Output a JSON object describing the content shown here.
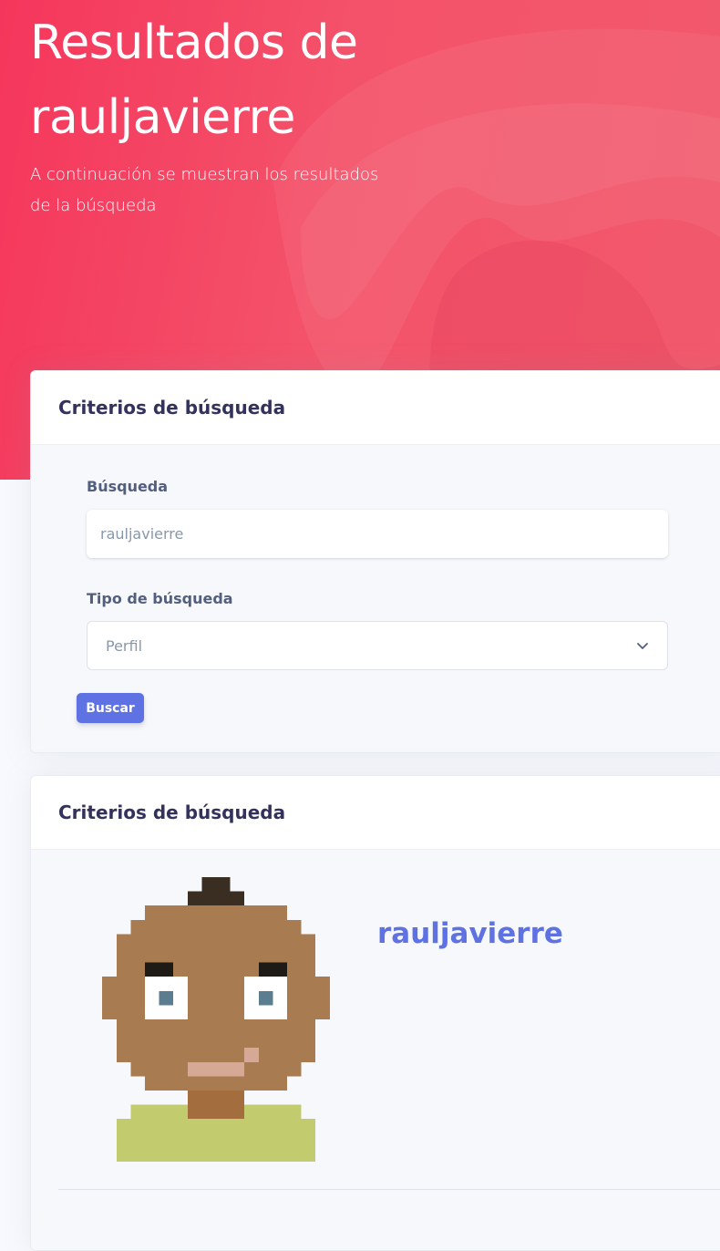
{
  "hero": {
    "title": "Resultados de rauljavierre",
    "subtitle": "A continuación se muestran los resultados de la búsqueda"
  },
  "search_card": {
    "title": "Criterios de búsqueda",
    "query_label": "Búsqueda",
    "query_value": "rauljavierre",
    "type_label": "Tipo de búsqueda",
    "type_value": "Perfil",
    "submit_label": "Buscar"
  },
  "results_card": {
    "title": "Criterios de búsqueda",
    "username": "rauljavierre"
  },
  "colors": {
    "hero": "#f5365c",
    "primary": "#5e72e4",
    "heading": "#32325d",
    "label": "#525f7f"
  },
  "icons": {
    "select": "chevron-down-icon",
    "avatar": "pixel-avatar-icon"
  }
}
